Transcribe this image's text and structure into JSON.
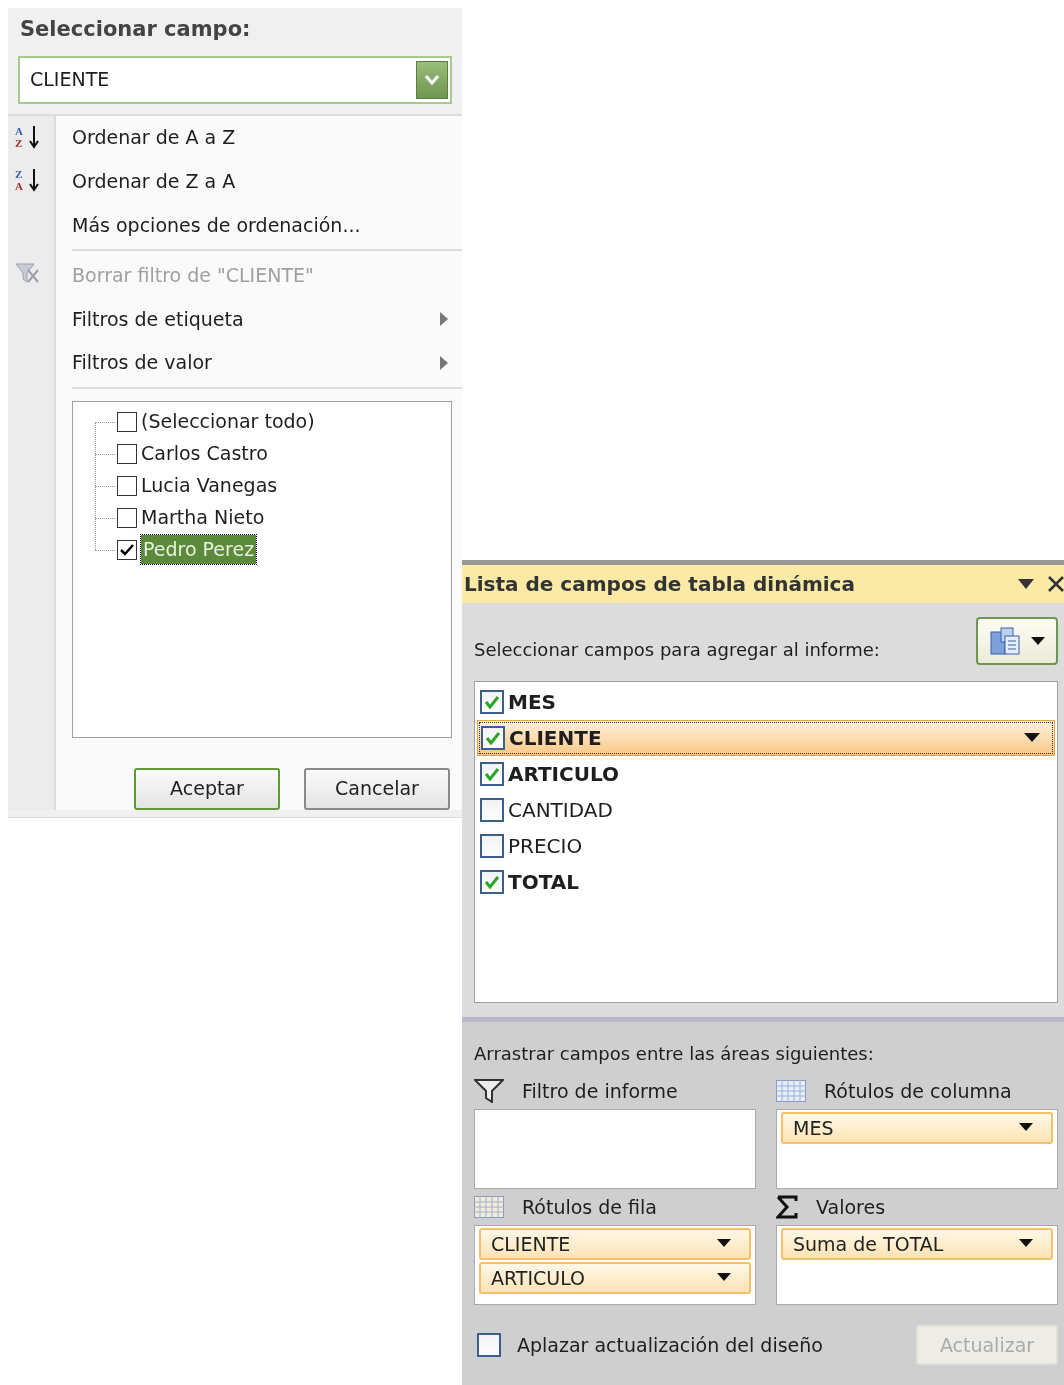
{
  "filter_menu": {
    "title": "Seleccionar campo:",
    "field_select": {
      "value": "CLIENTE"
    },
    "menu_groups": [
      [
        {
          "kind": "sort",
          "icon_letters": [
            "A",
            "Z"
          ],
          "label": "Ordenar de A a Z",
          "disabled": false,
          "submenu": false
        },
        {
          "kind": "sort",
          "icon_letters": [
            "Z",
            "A"
          ],
          "label": "Ordenar de Z a A",
          "disabled": false,
          "submenu": false
        },
        {
          "kind": "plain",
          "label": "Más opciones de ordenación...",
          "disabled": false,
          "submenu": false
        }
      ],
      [
        {
          "kind": "clear_filter",
          "label": "Borrar filtro de \"CLIENTE\"",
          "disabled": true,
          "submenu": false
        },
        {
          "kind": "plain",
          "label": "Filtros de etiqueta",
          "disabled": false,
          "submenu": true
        },
        {
          "kind": "plain",
          "label": "Filtros de valor",
          "disabled": false,
          "submenu": true
        }
      ]
    ],
    "checklist": [
      {
        "label": "(Seleccionar todo)",
        "checked": false,
        "selected": false
      },
      {
        "label": "Carlos Castro",
        "checked": false,
        "selected": false
      },
      {
        "label": "Lucia Vanegas",
        "checked": false,
        "selected": false
      },
      {
        "label": "Martha Nieto",
        "checked": false,
        "selected": false
      },
      {
        "label": "Pedro Perez",
        "checked": true,
        "selected": true
      }
    ],
    "buttons": [
      {
        "label": "Aceptar",
        "default": true
      },
      {
        "label": "Cancelar",
        "default": false
      }
    ]
  },
  "field_list": {
    "title": "Lista de campos de tabla dinámica",
    "prompt": "Seleccionar campos para agregar al informe:",
    "fields": [
      {
        "label": "MES",
        "checked": true,
        "selected": false
      },
      {
        "label": "CLIENTE",
        "checked": true,
        "selected": true
      },
      {
        "label": "ARTICULO",
        "checked": true,
        "selected": false
      },
      {
        "label": "CANTIDAD",
        "checked": false,
        "selected": false
      },
      {
        "label": "PRECIO",
        "checked": false,
        "selected": false
      },
      {
        "label": "TOTAL",
        "checked": true,
        "selected": false
      }
    ],
    "areas_prompt": "Arrastrar campos entre las áreas siguientes:",
    "areas": [
      {
        "kind": "filter",
        "label": "Filtro de informe"
      },
      {
        "kind": "columns",
        "label": "Rótulos de columna",
        "items": [
          "MES"
        ]
      },
      {
        "kind": "rows",
        "label": "Rótulos de fila",
        "items": [
          "CLIENTE",
          "ARTICULO"
        ]
      },
      {
        "kind": "values",
        "label": "Valores",
        "items": [
          "Suma de TOTAL"
        ]
      }
    ],
    "defer": {
      "label": "Aplazar actualización del diseño",
      "checked": false
    },
    "update_button": {
      "label": "Actualizar",
      "disabled": true
    }
  }
}
